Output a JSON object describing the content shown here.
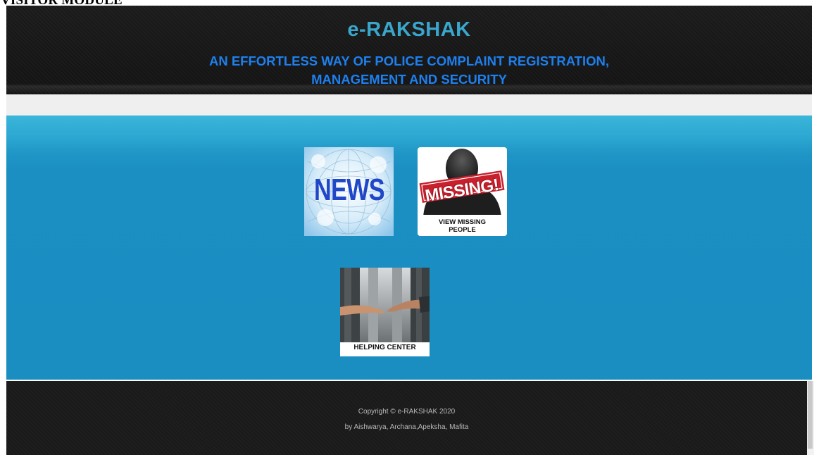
{
  "document": {
    "heading": ".VISITOR MODULE"
  },
  "header": {
    "brand": "e-RAKSHAK",
    "tagline_line1": "AN EFFORTLESS WAY OF POLICE COMPLAINT REGISTRATION,",
    "tagline_line2": "MANAGEMENT AND SECURITY"
  },
  "tiles": {
    "news": {
      "label": "NEWS",
      "icon": "news-icon"
    },
    "missing": {
      "stamp": "MISSING!",
      "caption_line1": "VIEW MISSING",
      "caption_line2": "PEOPLE",
      "icon": "missing-person-icon"
    },
    "helping": {
      "caption": "HELPING CENTER",
      "icon": "helping-hands-icon"
    }
  },
  "footer": {
    "copyright": "Copyright © e-RAKSHAK 2020",
    "authors": "by Aishwarya, Archana,Apeksha, Mafita"
  },
  "colors": {
    "brand": "#3aa6cc",
    "tagline": "#1e80ef",
    "main_bg": "#1a8dc1",
    "header_bg": "#161616"
  }
}
